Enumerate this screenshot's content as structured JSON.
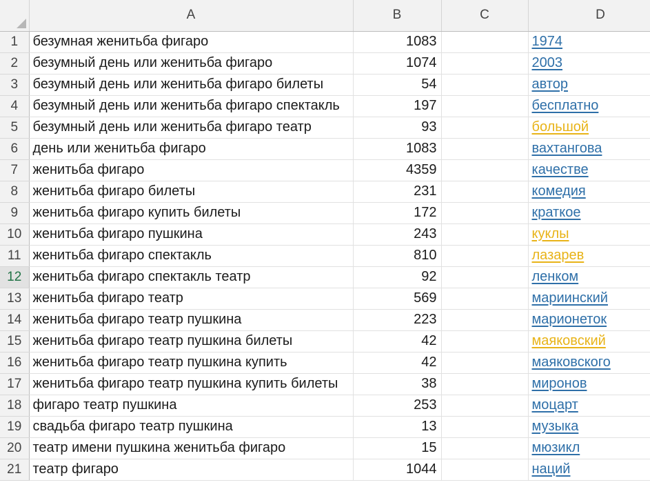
{
  "columns": [
    "",
    "A",
    "B",
    "C",
    "D"
  ],
  "active_row": "12",
  "rows": [
    {
      "n": "1",
      "a": "безумная женитьба фигаро",
      "b": "1083",
      "c": "",
      "d": "1974",
      "d_highlight": false
    },
    {
      "n": "2",
      "a": "безумный день или женитьба фигаро",
      "b": "1074",
      "c": "",
      "d": "2003",
      "d_highlight": false
    },
    {
      "n": "3",
      "a": "безумный день или женитьба фигаро билеты",
      "b": "54",
      "c": "",
      "d": "автор",
      "d_highlight": false
    },
    {
      "n": "4",
      "a": "безумный день или женитьба фигаро спектакль",
      "b": "197",
      "c": "",
      "d": "бесплатно",
      "d_highlight": false
    },
    {
      "n": "5",
      "a": "безумный день или женитьба фигаро театр",
      "b": "93",
      "c": "",
      "d": "большой",
      "d_highlight": true
    },
    {
      "n": "6",
      "a": "день или женитьба фигаро",
      "b": "1083",
      "c": "",
      "d": "вахтангова",
      "d_highlight": false
    },
    {
      "n": "7",
      "a": "женитьба фигаро",
      "b": "4359",
      "c": "",
      "d": "качестве",
      "d_highlight": false
    },
    {
      "n": "8",
      "a": "женитьба фигаро билеты",
      "b": "231",
      "c": "",
      "d": "комедия",
      "d_highlight": false
    },
    {
      "n": "9",
      "a": "женитьба фигаро купить билеты",
      "b": "172",
      "c": "",
      "d": "краткое",
      "d_highlight": false
    },
    {
      "n": "10",
      "a": "женитьба фигаро пушкина",
      "b": "243",
      "c": "",
      "d": "куклы",
      "d_highlight": true
    },
    {
      "n": "11",
      "a": "женитьба фигаро спектакль",
      "b": "810",
      "c": "",
      "d": "лазарев",
      "d_highlight": true
    },
    {
      "n": "12",
      "a": "женитьба фигаро спектакль театр",
      "b": "92",
      "c": "",
      "d": "ленком",
      "d_highlight": false
    },
    {
      "n": "13",
      "a": "женитьба фигаро театр",
      "b": "569",
      "c": "",
      "d": "мариинский",
      "d_highlight": false
    },
    {
      "n": "14",
      "a": "женитьба фигаро театр пушкина",
      "b": "223",
      "c": "",
      "d": "марионеток",
      "d_highlight": false
    },
    {
      "n": "15",
      "a": "женитьба фигаро театр пушкина билеты",
      "b": "42",
      "c": "",
      "d": "маяковский",
      "d_highlight": true
    },
    {
      "n": "16",
      "a": "женитьба фигаро театр пушкина купить",
      "b": "42",
      "c": "",
      "d": "маяковского",
      "d_highlight": false
    },
    {
      "n": "17",
      "a": "женитьба фигаро театр пушкина купить билеты",
      "b": "38",
      "c": "",
      "d": "миронов",
      "d_highlight": false
    },
    {
      "n": "18",
      "a": "фигаро театр пушкина",
      "b": "253",
      "c": "",
      "d": "моцарт",
      "d_highlight": false
    },
    {
      "n": "19",
      "a": "свадьба фигаро театр пушкина",
      "b": "13",
      "c": "",
      "d": "музыка",
      "d_highlight": false
    },
    {
      "n": "20",
      "a": "театр имени пушкина женитьба фигаро",
      "b": "15",
      "c": "",
      "d": "мюзикл",
      "d_highlight": false
    },
    {
      "n": "21",
      "a": "театр фигаро",
      "b": "1044",
      "c": "",
      "d": "наций",
      "d_highlight": false
    }
  ],
  "colors": {
    "link": "#2e6fa8",
    "link_highlight": "#e8b317",
    "active_row_number": "#217346",
    "header_bg": "#f2f2f2"
  }
}
